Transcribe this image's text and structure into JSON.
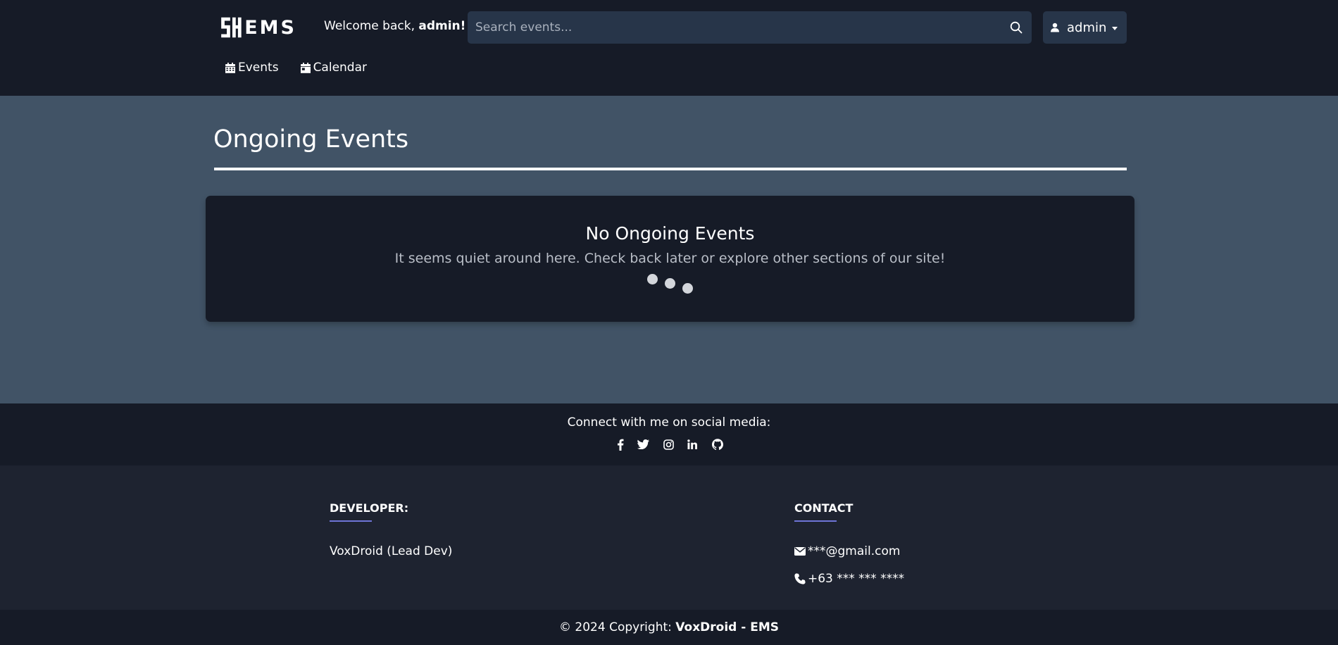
{
  "brand": {
    "logo_text": "EMS"
  },
  "header": {
    "welcome_prefix": "Welcome back, ",
    "welcome_user": "admin!",
    "search_placeholder": "Search events...",
    "user_menu_label": "admin",
    "nav": [
      {
        "label": "Events",
        "icon": "calendar-grid-icon"
      },
      {
        "label": "Calendar",
        "icon": "calendar-day-icon"
      }
    ]
  },
  "main": {
    "title": "Ongoing Events",
    "empty_title": "No Ongoing Events",
    "empty_message": "It seems quiet around here. Check back later or explore other sections of our site!"
  },
  "social": {
    "text": "Connect with me on social media:",
    "icons": [
      "facebook-icon",
      "twitter-icon",
      "instagram-icon",
      "linkedin-icon",
      "github-icon"
    ]
  },
  "footer": {
    "developer_heading": "DEVELOPER:",
    "developer_name": "VoxDroid (Lead Dev)",
    "contact_heading": "CONTACT",
    "email": "***@gmail.com",
    "phone": "+63 *** *** ****"
  },
  "copyright": {
    "prefix": "© 2024 Copyright: ",
    "owner": "VoxDroid - EMS"
  },
  "colors": {
    "header_bg": "#161b27",
    "page_bg": "#415366",
    "search_bg": "#273549",
    "footer_bg": "#1e2330",
    "accent_underline": "#6e74d6"
  }
}
